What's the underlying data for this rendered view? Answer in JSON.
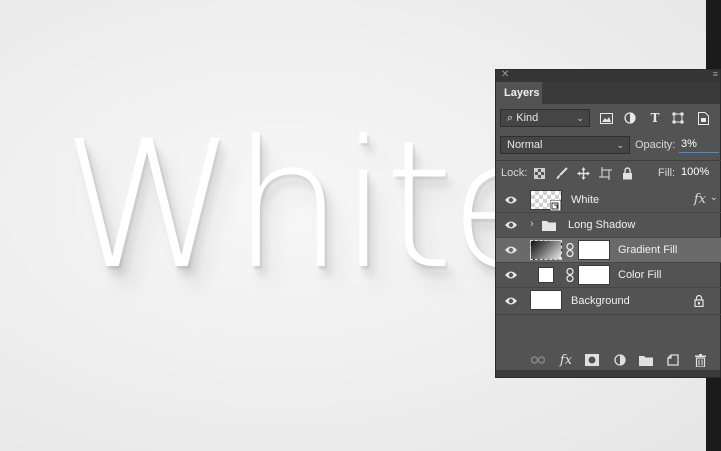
{
  "canvas": {
    "text": "White"
  },
  "panel": {
    "title": "Layers",
    "filter": {
      "value": "Kind",
      "search_glyph": "⌕"
    },
    "blend_mode": {
      "value": "Normal"
    },
    "opacity": {
      "label": "Opacity:",
      "value": "3%"
    },
    "lock": {
      "label": "Lock:"
    },
    "fill": {
      "label": "Fill:",
      "value": "100%"
    }
  },
  "layers": [
    {
      "name": "White",
      "kind": "smart-object",
      "visible": true,
      "fx": "fx",
      "selected": false
    },
    {
      "name": "Long Shadow",
      "kind": "group",
      "visible": true,
      "selected": false
    },
    {
      "name": "Gradient Fill",
      "kind": "gradient-fill",
      "visible": true,
      "selected": true
    },
    {
      "name": "Color Fill",
      "kind": "color-fill",
      "visible": true,
      "selected": false
    },
    {
      "name": "Background",
      "kind": "background",
      "visible": true,
      "locked": true,
      "selected": false
    }
  ],
  "bottom_toolbar": {
    "fx_label": "fx"
  },
  "colors": {
    "panel_bg": "#535353",
    "selected_row": "#6a6a6a",
    "accent": "#3d8ee6",
    "canvas_bg": "#efefef"
  }
}
